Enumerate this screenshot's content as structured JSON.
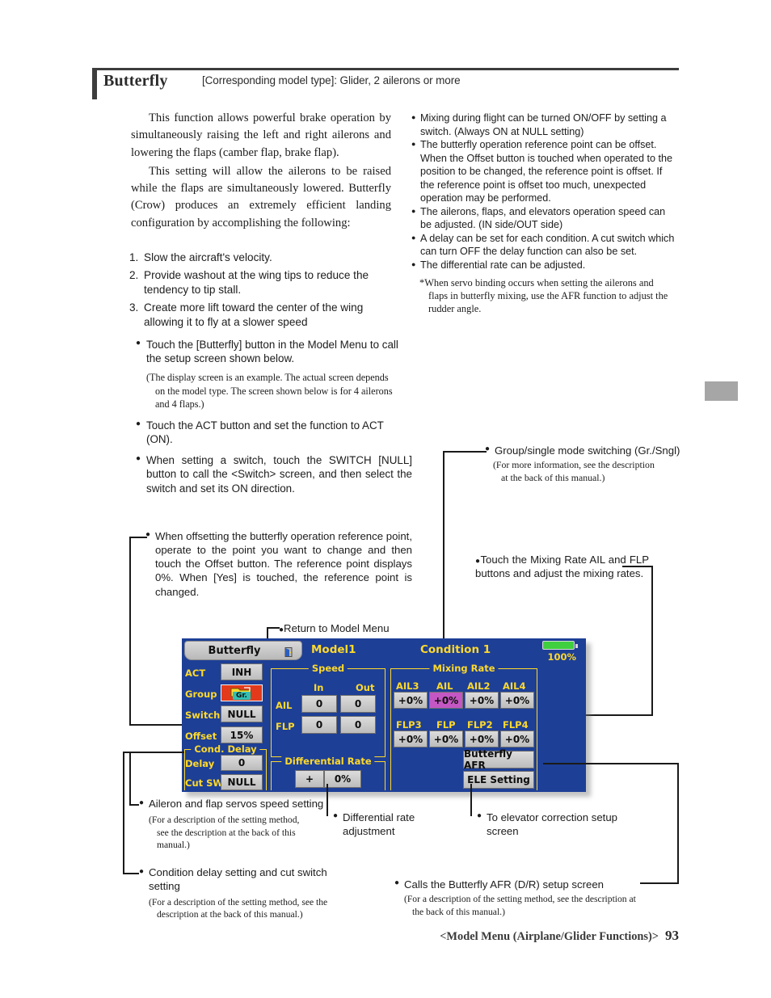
{
  "header": {
    "title": "Butterfly",
    "subtitle": "[Corresponding model type]: Glider, 2 ailerons or more"
  },
  "intro": {
    "para1": "This function allows powerful brake operation by simultaneously raising the left and right ailerons and lowering the flaps (camber flap, brake flap).",
    "para2": "This setting will allow the ailerons to be raised while the flaps are simultaneously lowered. Butterfly (Crow) produces an extremely efficient landing configuration by accomplishing the following:",
    "numbered": [
      {
        "n": "1.",
        "text": "Slow the aircraft's velocity."
      },
      {
        "n": "2.",
        "text": "Provide washout at the wing tips to reduce the tendency to tip stall."
      },
      {
        "n": "3.",
        "text": "Create more lift toward the center of the wing allowing it to fly at a slower speed"
      }
    ]
  },
  "features": {
    "bullets": [
      "Mixing during flight can be turned ON/OFF by setting a switch. (Always ON at NULL setting)",
      "The butterfly operation reference point can be offset. When the Offset button is touched when operated to the position to be changed, the reference point is offset. If the reference point is offset too much, unexpected operation may be performed.",
      "The ailerons, flaps, and elevators operation speed can be adjusted. (IN side/OUT side)",
      "A delay can be set for each condition. A cut switch which can turn OFF the delay function can also be set.",
      "The differential rate can be adjusted."
    ],
    "note_line1": "*When servo binding occurs when setting the ailerons and",
    "note_line2": "flaps in butterfly mixing, use the AFR function to adjust the",
    "note_line3": "rudder angle."
  },
  "instructions": {
    "b1": "Touch the [Butterfly] button in the Model Menu to call the setup screen shown below.",
    "b1_note_l1": "(The display screen is an example. The actual screen depends",
    "b1_note_l2": "on the model type. The screen shown below is for 4 ailerons",
    "b1_note_l3": "and 4 flaps.)",
    "b2": "Touch the ACT button and set the function to ACT (ON).",
    "b3": "When setting a switch, touch the SWITCH [NULL] button to call the <Switch> screen, and then select the switch and set its ON direction."
  },
  "callouts": {
    "offset": "When offsetting the butterfly operation reference point, operate to the point you want to change and then touch the Offset button. The reference point displays 0%. When [Yes] is touched, the reference point is changed.",
    "group_mode_title": "Group/single mode switching (Gr./Sngl)",
    "group_mode_note_l1": "(For more information, see the description",
    "group_mode_note_l2": "at the back of this manual.)",
    "mixing_rate": "Touch the Mixing Rate AIL and FLP buttons and adjust the mixing rates.",
    "return_to_model_menu": "Return to Model Menu",
    "aileron_flap_speed": "Aileron and flap servos speed setting",
    "aileron_flap_speed_note_l1": "(For a description of the setting method,",
    "aileron_flap_speed_note_l2": "see the description at the back of this",
    "aileron_flap_speed_note_l3": "manual.)",
    "cond_delay": "Condition delay setting and cut switch setting",
    "cond_delay_note_l1": "(For a description of the setting method, see the",
    "cond_delay_note_l2": "description at the back of this manual.)",
    "differential": "Differential rate adjustment",
    "elevator": "To elevator correction setup screen",
    "afr": "Calls the Butterfly AFR (D/R) setup screen",
    "afr_note_l1": "(For a description of the setting method, see the description at",
    "afr_note_l2": "the back of this manual.)"
  },
  "lcd": {
    "title_button": "Butterfly",
    "model": "Model1",
    "condition": "Condition 1",
    "battery_percent": "100%",
    "left_panel": {
      "act_label": "ACT",
      "act_value": "INH",
      "group_label": "Group",
      "group_value": "Gr.",
      "switch_label": "Switch",
      "switch_value": "NULL",
      "offset_label": "Offset",
      "offset_value": "15%",
      "cond_delay_caption": "Cond. Delay",
      "delay_label": "Delay",
      "delay_value": "0",
      "cutsw_label": "Cut SW",
      "cutsw_value": "NULL"
    },
    "speed_panel": {
      "caption": "Speed",
      "col_in": "In",
      "col_out": "Out",
      "rows": [
        {
          "label": "AIL",
          "in": "0",
          "out": "0"
        },
        {
          "label": "FLP",
          "in": "0",
          "out": "0"
        }
      ]
    },
    "differential_panel": {
      "caption": "Differential Rate",
      "sign": "+",
      "value": "0%"
    },
    "mixing_panel": {
      "caption": "Mixing Rate",
      "row1": [
        {
          "label": "AIL3",
          "value": "+0%",
          "selected": false
        },
        {
          "label": "AIL",
          "value": "+0%",
          "selected": true
        },
        {
          "label": "AIL2",
          "value": "+0%",
          "selected": false
        },
        {
          "label": "AIL4",
          "value": "+0%",
          "selected": false
        }
      ],
      "row2": [
        {
          "label": "FLP3",
          "value": "+0%",
          "selected": false
        },
        {
          "label": "FLP",
          "value": "+0%",
          "selected": false
        },
        {
          "label": "FLP2",
          "value": "+0%",
          "selected": false
        },
        {
          "label": "FLP4",
          "value": "+0%",
          "selected": false
        }
      ],
      "afr_button": "Butterfly AFR",
      "ele_button": "ELE Setting"
    },
    "colors": {
      "background": "#1d3f96",
      "accent_yellow": "#ffd92b",
      "selected": "#c457c4",
      "group_red": "#e33a1c",
      "battery_green": "#3fcf3f"
    }
  },
  "footer": {
    "section": "<Model Menu (Airplane/Glider Functions)>",
    "page": "93"
  }
}
